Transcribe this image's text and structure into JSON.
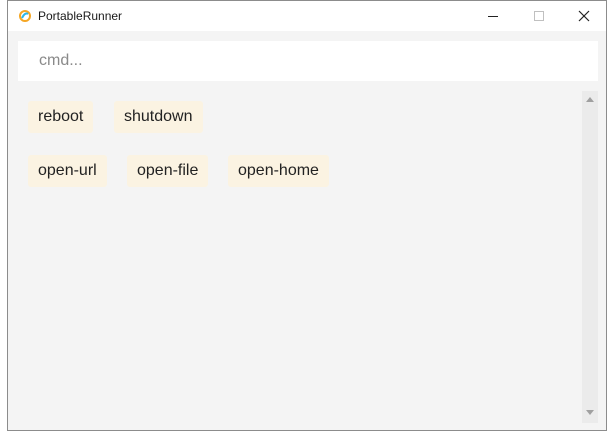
{
  "window": {
    "title": "PortableRunner",
    "controls": [
      "minimize-icon",
      "maximize-icon",
      "close-icon"
    ]
  },
  "command_input": {
    "placeholder": "cmd...",
    "value": ""
  },
  "command_buttons": [
    {
      "label": "reboot"
    },
    {
      "label": "shutdown"
    },
    {
      "label": "open-url"
    },
    {
      "label": "open-file"
    },
    {
      "label": "open-home"
    }
  ],
  "colors": {
    "window_background": "#f4f4f4",
    "button_background": "#fbf3e2",
    "titlebar_background": "#ffffff"
  }
}
